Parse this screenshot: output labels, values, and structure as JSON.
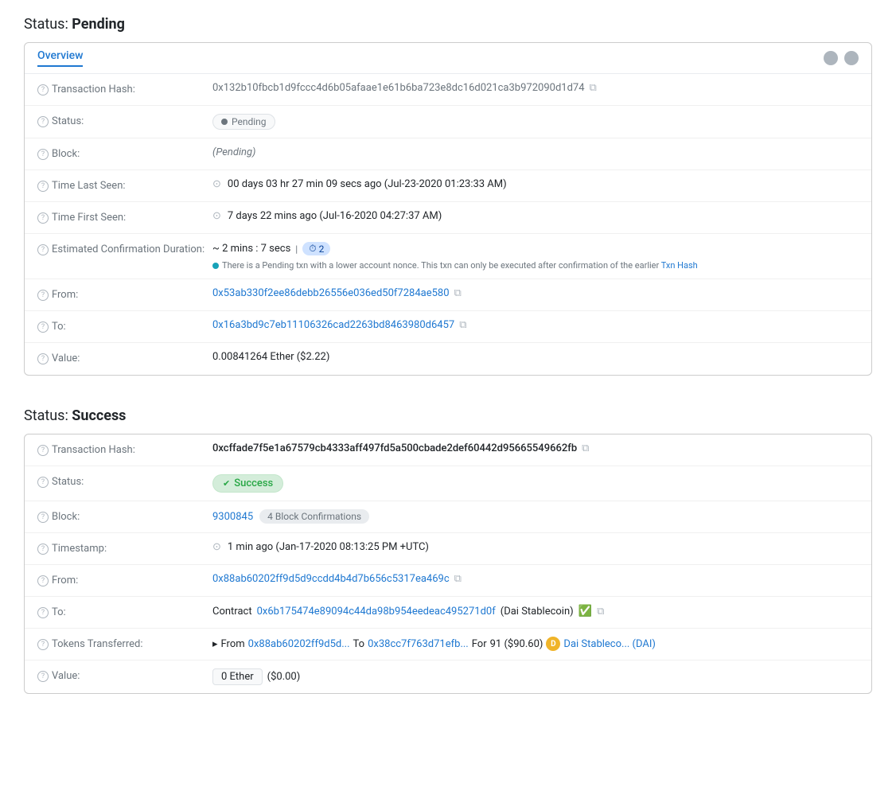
{
  "pending_section": {
    "title": "Status:",
    "title_bold": "Pending",
    "card": {
      "tab": "Overview",
      "rows": [
        {
          "label": "Transaction Hash:",
          "value_type": "hash_copy",
          "hash": "0x132b10fbcb1d9fccc4d6b05afaae1e61b6ba723e8dc16d021ca3b972090d1d74",
          "copy": true
        },
        {
          "label": "Status:",
          "value_type": "badge_pending",
          "badge_text": "Pending"
        },
        {
          "label": "Block:",
          "value_type": "italic",
          "text": "(Pending)"
        },
        {
          "label": "Time Last Seen:",
          "value_type": "clock_text",
          "text": "00 days 03 hr 27 min 09 secs ago (Jul-23-2020 01:23:33 AM)"
        },
        {
          "label": "Time First Seen:",
          "value_type": "clock_text",
          "text": "7 days 22 mins ago (Jul-16-2020 04:27:37 AM)"
        },
        {
          "label": "Estimated Confirmation Duration:",
          "value_type": "duration",
          "duration": "~ 2 mins : 7 secs",
          "badge_num": "2",
          "warning": "There is a Pending txn with a lower account nonce. This txn can only be executed after confirmation of the earlier Txn Hash"
        },
        {
          "label": "From:",
          "value_type": "link_copy",
          "link": "0x53ab330f2ee86debb26556e036ed50f7284ae580"
        },
        {
          "label": "To:",
          "value_type": "link_copy",
          "link": "0x16a3bd9c7eb11106326cad2263bd8463980d6457"
        },
        {
          "label": "Value:",
          "value_type": "plain",
          "text": "0.00841264 Ether ($2.22)"
        }
      ]
    }
  },
  "success_section": {
    "title": "Status:",
    "title_bold": "Success",
    "card": {
      "rows": [
        {
          "label": "Transaction Hash:",
          "value_type": "hash_copy_bold",
          "hash": "0xcffade7f5e1a67579cb4333aff497fd5a500cbade2def60442d95665549662fb",
          "copy": true
        },
        {
          "label": "Status:",
          "value_type": "badge_success",
          "badge_text": "Success"
        },
        {
          "label": "Block:",
          "value_type": "block_confirmations",
          "block_num": "9300845",
          "confirmations": "4 Block Confirmations"
        },
        {
          "label": "Timestamp:",
          "value_type": "clock_text",
          "text": "1 min ago (Jan-17-2020 08:13:25 PM +UTC)"
        },
        {
          "label": "From:",
          "value_type": "link_copy",
          "link": "0x88ab60202ff9d5d9ccdd4b4d7b656c5317ea469c"
        },
        {
          "label": "To:",
          "value_type": "contract_link",
          "prefix": "Contract",
          "link": "0x6b175474e89094c44da98b954eedeac495271d0f",
          "link_label": "0x6b175474e89094c44da98b954eedeac495271d0f",
          "contract_name": "(Dai Stablecoin)",
          "verified": true,
          "copy": true
        },
        {
          "label": "Tokens Transferred:",
          "value_type": "token_transfer",
          "arrow": "▸",
          "from_label": "From",
          "from_link": "0x88ab60202ff9d5d...",
          "to_label": "To",
          "to_link": "0x38cc7f763d71efb...",
          "for_label": "For",
          "amount": "91 ($90.60)",
          "token_icon": "🪙",
          "token_name": "Dai Stableco... (DAI)"
        },
        {
          "label": "Value:",
          "value_type": "value_box",
          "ether": "0 Ether",
          "usd": "($0.00)"
        }
      ]
    }
  },
  "labels": {
    "help_icon": "?",
    "copy_icon": "⧉",
    "clock": "⊙"
  }
}
